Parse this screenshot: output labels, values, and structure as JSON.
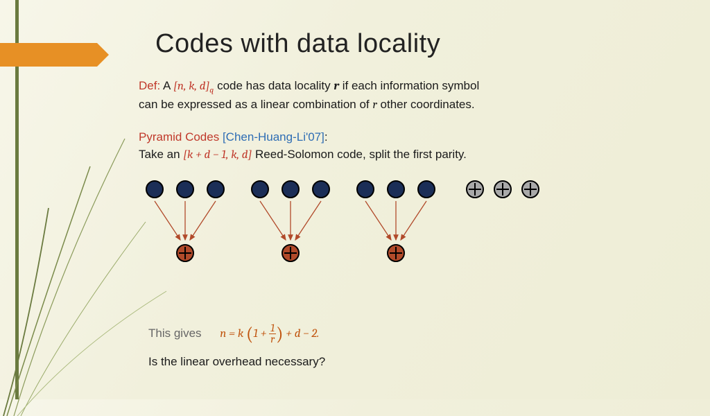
{
  "title": "Codes with data locality",
  "def": {
    "label": "Def:",
    "pre": "A",
    "code": "[n, k, d]",
    "codesub": "q",
    "mid": "code has data locality",
    "rvar": "r",
    "post1": "if each information symbol",
    "post2": "can be expressed as a linear combination of",
    "rvar2": "r",
    "post3": "other  coordinates."
  },
  "pyr": {
    "name": "Pyramid Codes",
    "cite": "[Chen-Huang-Li'07]",
    "colon": ":",
    "take": "Take an",
    "code": "[k + d − 1, k, d]",
    "rest": "Reed-Solomon code, split the first parity."
  },
  "diagram": {
    "navy_count": 9,
    "gray_count": 3,
    "groups": 3
  },
  "foot": {
    "gives": "This gives",
    "eq_pre": "n = k",
    "eq_frac_n": "1",
    "eq_frac_d": "r",
    "eq_post": " + d  − 2.",
    "question": "Is the linear overhead necessary?"
  }
}
